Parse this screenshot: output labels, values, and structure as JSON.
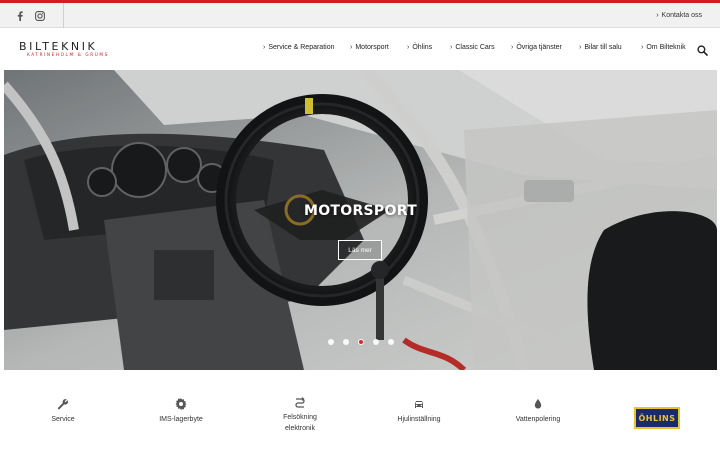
{
  "topbar": {
    "social": [
      "facebook-icon",
      "instagram-icon"
    ],
    "contact_label": "Kontakta oss"
  },
  "brand": {
    "name": "BILTEKNIK",
    "sub": "KATRINEHOLM & GRUMS",
    "accent": "#d71920"
  },
  "nav": {
    "items": [
      {
        "label": "Service & Reparation"
      },
      {
        "label": "Motorsport"
      },
      {
        "label": "Öhlins"
      },
      {
        "label": "Classic Cars"
      },
      {
        "label": "Övriga tjänster"
      },
      {
        "label": "Bilar till salu"
      },
      {
        "label": "Om Bilteknik"
      }
    ],
    "search_icon": "search-icon"
  },
  "hero": {
    "title": "MOTORSPORT",
    "button_label": "Läs mer",
    "slide_count": 5,
    "active_slide": 3
  },
  "services": {
    "items": [
      {
        "label": "Service",
        "icon": "wrench-icon"
      },
      {
        "label": "IMS-lagerbyte",
        "icon": "gear-icon"
      },
      {
        "label": "Felsökning elektronik",
        "icon": "diagnostics-icon"
      },
      {
        "label": "Hjulinställning",
        "icon": "car-icon"
      },
      {
        "label": "Vattenpolering",
        "icon": "water-drop-icon"
      }
    ],
    "partner_logo": "ÖHLINS"
  }
}
